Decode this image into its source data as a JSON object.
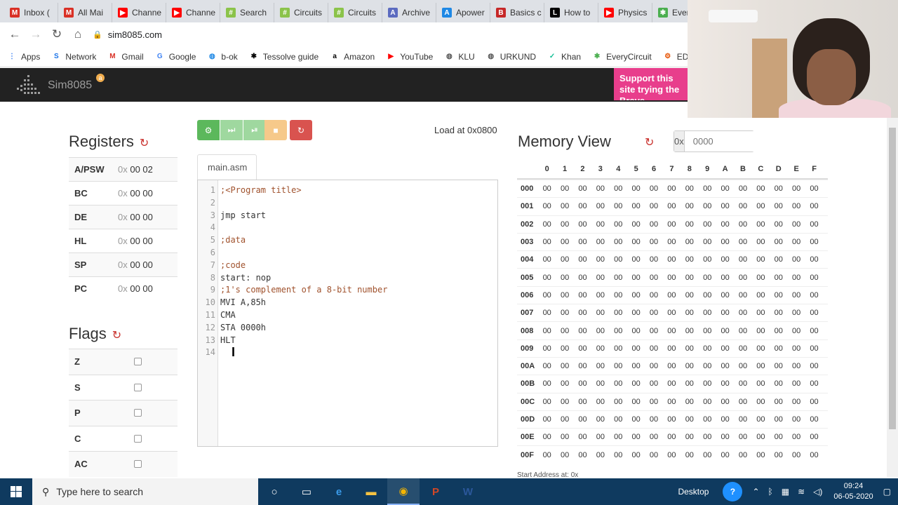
{
  "browser": {
    "tabs": [
      {
        "label": "Inbox (",
        "icon": "gmail-icon",
        "color": "#d93025",
        "glyph": "M"
      },
      {
        "label": "All Mai",
        "icon": "gmail-icon",
        "color": "#d93025",
        "glyph": "M"
      },
      {
        "label": "Channe",
        "icon": "youtube-icon",
        "color": "#ff0000",
        "glyph": "▶"
      },
      {
        "label": "Channe",
        "icon": "youtube-icon",
        "color": "#ff0000",
        "glyph": "▶"
      },
      {
        "label": "Search",
        "icon": "grid-icon",
        "color": "#8bc34a",
        "glyph": "#"
      },
      {
        "label": "Circuits",
        "icon": "grid-icon",
        "color": "#8bc34a",
        "glyph": "#"
      },
      {
        "label": "Circuits",
        "icon": "grid-icon",
        "color": "#8bc34a",
        "glyph": "#"
      },
      {
        "label": "Archive",
        "icon": "archive-icon",
        "color": "#5c6bc0",
        "glyph": "A"
      },
      {
        "label": "Apower",
        "icon": "apower-icon",
        "color": "#1e88e5",
        "glyph": "A"
      },
      {
        "label": "Basics c",
        "icon": "basics-icon",
        "color": "#c62828",
        "glyph": "B"
      },
      {
        "label": "How to",
        "icon": "l-icon",
        "color": "#000000",
        "glyph": "L"
      },
      {
        "label": "Physics",
        "icon": "youtube-icon",
        "color": "#ff0000",
        "glyph": "▶"
      },
      {
        "label": "EveryC",
        "icon": "everycircuit-icon",
        "color": "#4caf50",
        "glyph": "✱"
      }
    ],
    "url": "sim8085.com",
    "bookmarks": [
      {
        "label": "Apps",
        "icon": "apps-icon",
        "color": "#4285f4",
        "glyph": "⋮"
      },
      {
        "label": "Network",
        "icon": "network-icon",
        "color": "#1a73e8",
        "glyph": "S"
      },
      {
        "label": "Gmail",
        "icon": "gmail-icon",
        "color": "#d93025",
        "glyph": "M"
      },
      {
        "label": "Google",
        "icon": "google-icon",
        "color": "#4285f4",
        "glyph": "G"
      },
      {
        "label": "b-ok",
        "icon": "globe-icon",
        "color": "#1e88e5",
        "glyph": "◍"
      },
      {
        "label": "Tessolve guide",
        "icon": "tessolve-icon",
        "color": "#000000",
        "glyph": "✱"
      },
      {
        "label": "Amazon",
        "icon": "amazon-icon",
        "color": "#000000",
        "glyph": "a"
      },
      {
        "label": "YouTube",
        "icon": "youtube-icon",
        "color": "#ff0000",
        "glyph": "▶"
      },
      {
        "label": "KLU",
        "icon": "globe-icon",
        "color": "#555555",
        "glyph": "◍"
      },
      {
        "label": "URKUND",
        "icon": "globe-icon",
        "color": "#555555",
        "glyph": "◍"
      },
      {
        "label": "Khan",
        "icon": "khan-icon",
        "color": "#14bf96",
        "glyph": "✓"
      },
      {
        "label": "EveryCircuit",
        "icon": "everycircuit-icon",
        "color": "#4caf50",
        "glyph": "✱"
      },
      {
        "label": "EDUKA",
        "icon": "gear-icon",
        "color": "#e65100",
        "glyph": "⚙"
      }
    ]
  },
  "app": {
    "brand": "Sim8085",
    "badge": "a",
    "ad_text": "Support this site trying the Brave"
  },
  "registers": {
    "title": "Registers",
    "rows": [
      {
        "name": "A/PSW",
        "prefix": "0x",
        "value": "00 02"
      },
      {
        "name": "BC",
        "prefix": "0x",
        "value": "00 00"
      },
      {
        "name": "DE",
        "prefix": "0x",
        "value": "00 00"
      },
      {
        "name": "HL",
        "prefix": "0x",
        "value": "00 00"
      },
      {
        "name": "SP",
        "prefix": "0x",
        "value": "00 00"
      },
      {
        "name": "PC",
        "prefix": "0x",
        "value": "00 00"
      }
    ]
  },
  "flags": {
    "title": "Flags",
    "rows": [
      "Z",
      "S",
      "P",
      "C",
      "AC"
    ]
  },
  "toolbar": {
    "buttons": [
      {
        "name": "assemble-button",
        "icon": "assemble-icon",
        "color": "#5cb85c",
        "glyph": "⚙"
      },
      {
        "name": "run-button",
        "icon": "fast-forward-icon",
        "color": "#9fd89f",
        "glyph": "⏭"
      },
      {
        "name": "step-button",
        "icon": "step-icon",
        "color": "#9fd89f",
        "glyph": "⏯"
      },
      {
        "name": "stop-button",
        "icon": "stop-icon",
        "color": "#f6c98a",
        "glyph": "■"
      },
      {
        "name": "reset-button",
        "icon": "refresh-icon",
        "color": "#d9534f",
        "glyph": "↻"
      }
    ],
    "load_at": "Load at 0x0800"
  },
  "editor": {
    "tab": "main.asm",
    "lines": [
      {
        "n": "1",
        "text": ";<Program title>",
        "cls": "cmt"
      },
      {
        "n": "2",
        "text": "",
        "cls": "kw"
      },
      {
        "n": "3",
        "text": "jmp start",
        "cls": "kw"
      },
      {
        "n": "4",
        "text": "",
        "cls": "kw"
      },
      {
        "n": "5",
        "text": ";data",
        "cls": "cmt"
      },
      {
        "n": "6",
        "text": "",
        "cls": "kw"
      },
      {
        "n": "7",
        "text": ";code",
        "cls": "cmt"
      },
      {
        "n": "8",
        "text": "start: nop",
        "cls": "kw"
      },
      {
        "n": "9",
        "text": ";1's complement of a 8-bit number",
        "cls": "cmt"
      },
      {
        "n": "10",
        "text": "MVI A,85h",
        "cls": "kw"
      },
      {
        "n": "11",
        "text": "CMA",
        "cls": "kw"
      },
      {
        "n": "12",
        "text": "STA 0000h",
        "cls": "kw"
      },
      {
        "n": "13",
        "text": "HLT",
        "cls": "kw"
      },
      {
        "n": "14",
        "text": "",
        "cls": "kw"
      }
    ]
  },
  "memory": {
    "title": "Memory View",
    "addr_prefix": "0x",
    "addr_placeholder": "0000",
    "cols": [
      "0",
      "1",
      "2",
      "3",
      "4",
      "5",
      "6",
      "7",
      "8",
      "9",
      "A",
      "B",
      "C",
      "D",
      "E",
      "F"
    ],
    "rows": [
      "000",
      "001",
      "002",
      "003",
      "004",
      "005",
      "006",
      "007",
      "008",
      "009",
      "00A",
      "00B",
      "00C",
      "00D",
      "00E",
      "00F"
    ],
    "cell_value": "00",
    "footer": "Start Address at: 0x"
  },
  "taskbar": {
    "search_placeholder": "Type here to search",
    "desktop_label": "Desktop",
    "time": "09:24",
    "date": "06-05-2020"
  }
}
